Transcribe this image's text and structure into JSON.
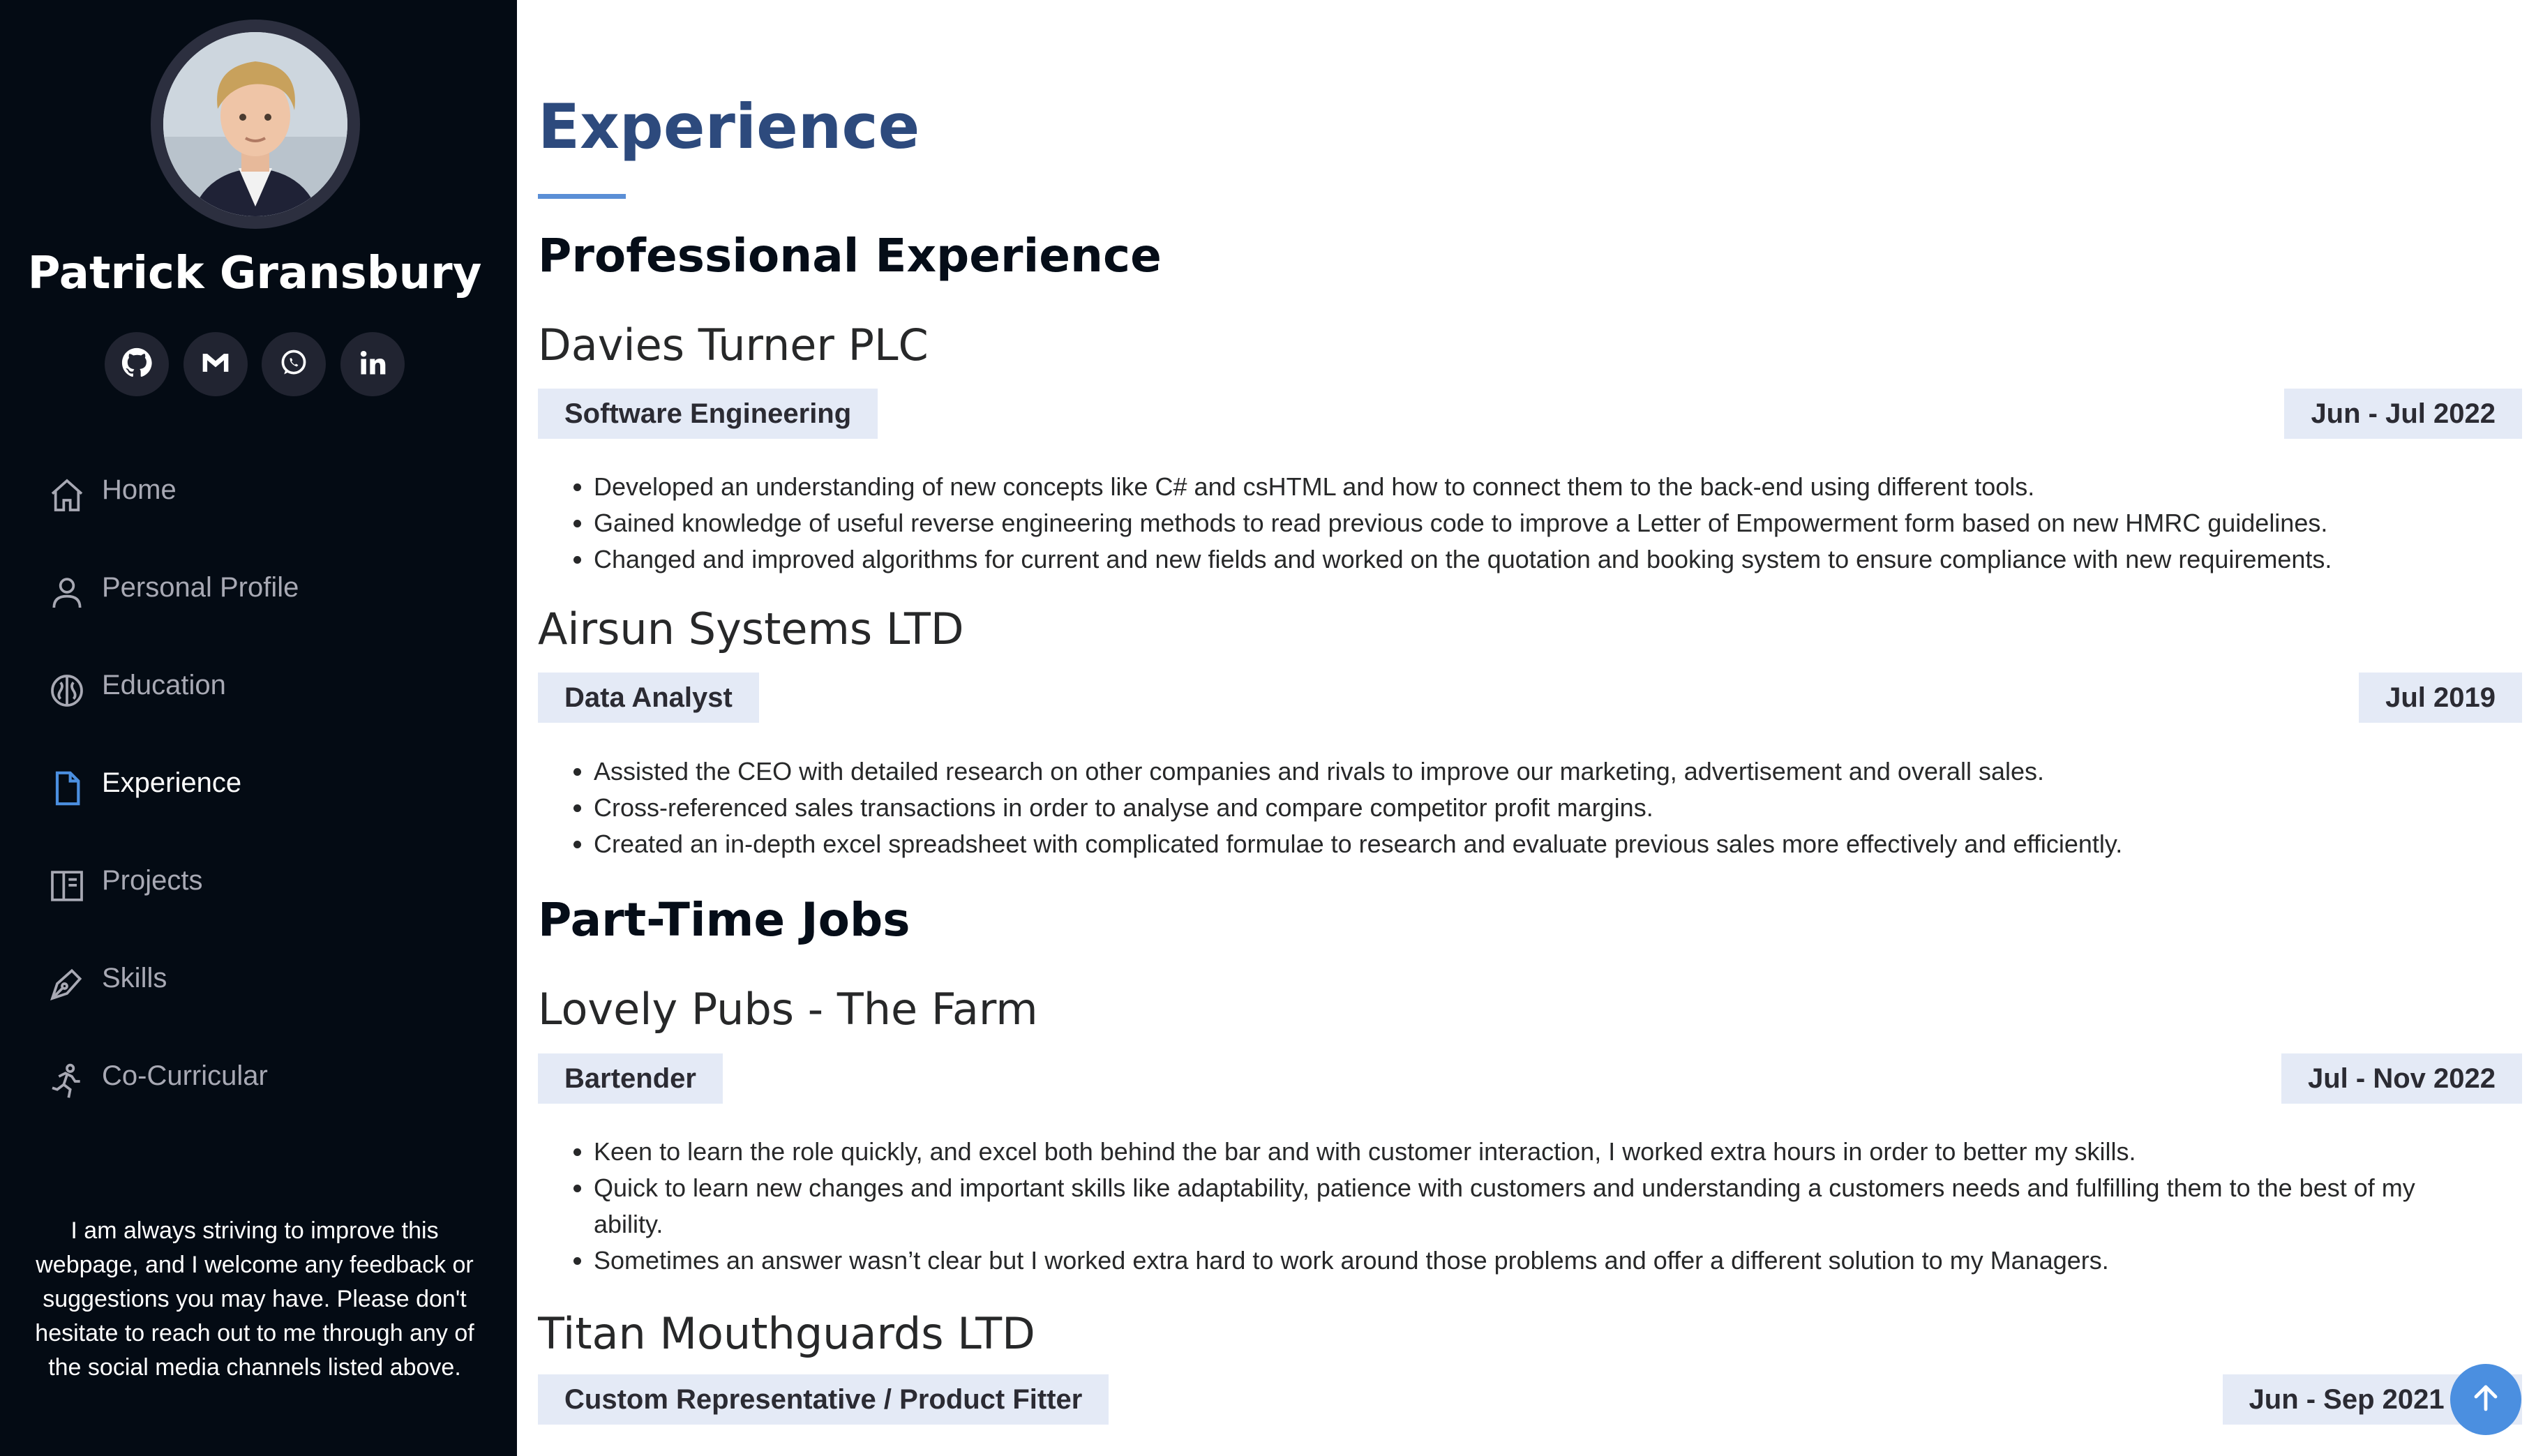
{
  "profile": {
    "name": "Patrick Gransbury"
  },
  "socials": [
    {
      "icon": "github-icon"
    },
    {
      "icon": "gmail-icon"
    },
    {
      "icon": "whatsapp-icon"
    },
    {
      "icon": "linkedin-icon"
    }
  ],
  "nav": {
    "items": [
      {
        "label": "Home",
        "icon": "home-icon"
      },
      {
        "label": "Personal Profile",
        "icon": "person-icon"
      },
      {
        "label": "Education",
        "icon": "brain-icon"
      },
      {
        "label": "Experience",
        "icon": "file-icon",
        "active": true
      },
      {
        "label": "Projects",
        "icon": "book-icon"
      },
      {
        "label": "Skills",
        "icon": "pen-icon"
      },
      {
        "label": "Co-Curricular",
        "icon": "running-icon"
      }
    ]
  },
  "sidebar_note": "I am always striving to improve this webpage, and I welcome any feedback or suggestions you may have. Please don't hesitate to reach out to me through any of the social media channels listed above.",
  "page": {
    "title": "Experience"
  },
  "sections": {
    "professional": "Professional Experience",
    "part_time": "Part-Time Jobs"
  },
  "jobs": [
    {
      "company": "Davies Turner PLC",
      "role": "Software Engineering",
      "date": "Jun - Jul 2022",
      "bullets": [
        "Developed an understanding of new concepts like C# and csHTML and how to connect them to the back-end using different tools.",
        "Gained knowledge of useful reverse engineering methods to read previous code to improve a Letter of Empowerment form based on new HMRC guidelines.",
        "Changed and improved algorithms for current and new fields and worked on the quotation and booking system to ensure compliance with new requirements."
      ]
    },
    {
      "company": "Airsun Systems LTD",
      "role": "Data Analyst",
      "date": "Jul 2019",
      "bullets": [
        "Assisted the CEO with detailed research on other companies and rivals to improve our marketing, advertisement and overall sales.",
        "Cross-referenced sales transactions in order to analyse and compare competitor profit margins.",
        "Created an in-depth excel spreadsheet with complicated formulae to research and evaluate previous sales more effectively and efficiently."
      ]
    },
    {
      "company": "Lovely Pubs - The Farm",
      "role": "Bartender",
      "date": "Jul - Nov 2022",
      "bullets": [
        "Keen to learn the role quickly, and excel both behind the bar and with customer interaction, I worked extra hours in order to better my skills.",
        "Quick to learn new changes and important skills like adaptability, patience with customers and understanding a customers needs and fulfilling them to the best of my ability.",
        "Sometimes an answer wasn’t clear but I worked extra hard to work around those problems and offer a different solution to my Managers."
      ]
    },
    {
      "company": "Titan Mouthguards LTD",
      "role": "Custom Representative / Product Fitter",
      "date": "Jun - Sep 2021 & 2"
    }
  ],
  "colors": {
    "sidebar_bg": "#040b14",
    "accent": "#2d4a7d",
    "rule": "#5b8fd6",
    "badge_bg": "#e4eaf6",
    "back_to_top": "#4b8fe0"
  }
}
